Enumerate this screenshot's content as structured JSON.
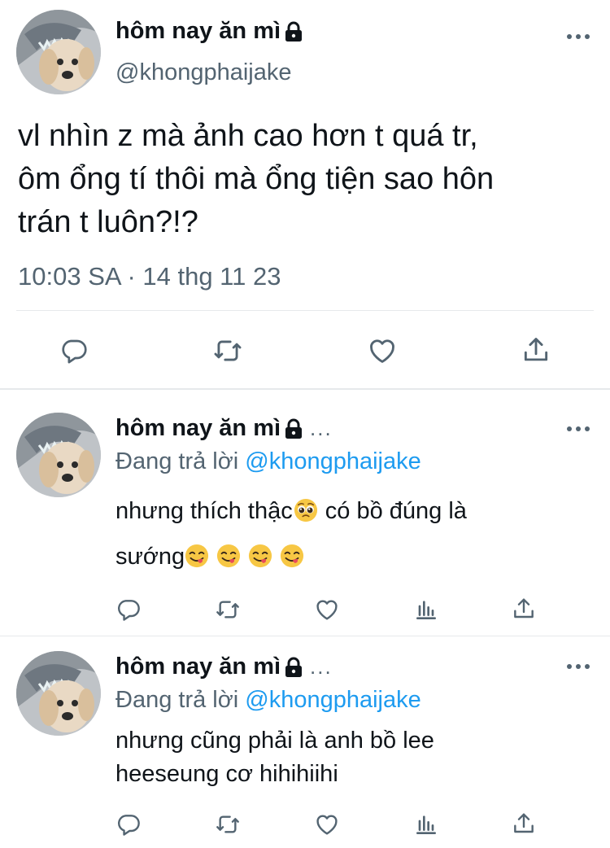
{
  "main_tweet": {
    "display_name": "hôm nay ăn mì",
    "handle": "@khongphaijake",
    "text_lines": [
      "vl nhìn z mà ảnh cao hơn t quá tr,",
      "ôm ổng tí thôi mà ổng tiện sao hôn",
      "trán t luôn?!?"
    ],
    "timestamp": "10:03 SA · 14 thg 11 23",
    "icons": [
      "reply-icon",
      "retweet-icon",
      "like-icon",
      "share-icon"
    ]
  },
  "replies": [
    {
      "display_name": "hôm nay ăn mì",
      "ellipsis": "...",
      "reply_prefix": "Đang trả lời ",
      "reply_mention": "@khongphaijake",
      "text_line1_a": "nhưng thích thậc",
      "text_line1_emoji": "pleading-face",
      "text_line1_b": " có bồ đúng là",
      "text_line2": "sướng",
      "text_line2_emojis": [
        "yum-face",
        "yum-face",
        "yum-face",
        "yum-face"
      ]
    },
    {
      "display_name": "hôm nay ăn mì",
      "ellipsis": "...",
      "reply_prefix": "Đang trả lời ",
      "reply_mention": "@khongphaijake",
      "text_line1": "nhưng cũng phải là anh bồ lee",
      "text_line2": "heeseung cơ hihihiihi"
    }
  ],
  "colors": {
    "text": "#0f1419",
    "secondary": "#536471",
    "mention": "#1d9bf0",
    "divider": "#e6e9eb"
  }
}
